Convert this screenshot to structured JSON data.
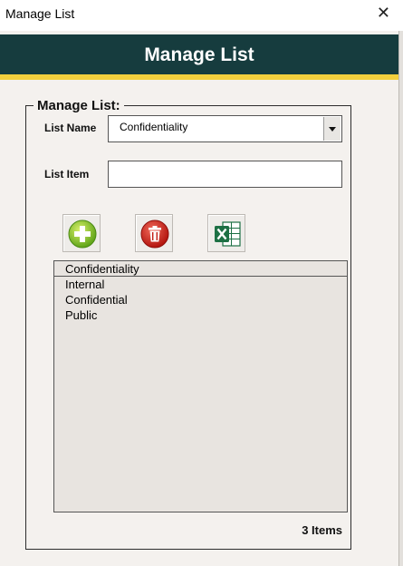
{
  "window": {
    "title": "Manage List",
    "close_glyph": "✕"
  },
  "header": {
    "title": "Manage List",
    "bg_color": "#163c3e",
    "accent_color": "#f2cf3d"
  },
  "group": {
    "legend": "Manage List:"
  },
  "form": {
    "list_name_label": "List Name",
    "list_name_value": "Confidentiality",
    "list_item_label": "List Item",
    "list_item_value": ""
  },
  "toolbar": {
    "add_icon": "add-icon",
    "delete_icon": "trash-icon",
    "export_icon": "excel-icon"
  },
  "list": {
    "header": "Confidentiality",
    "items": [
      "Internal",
      "Confidential",
      "Public"
    ]
  },
  "footer": {
    "count_label": "3 Items"
  }
}
